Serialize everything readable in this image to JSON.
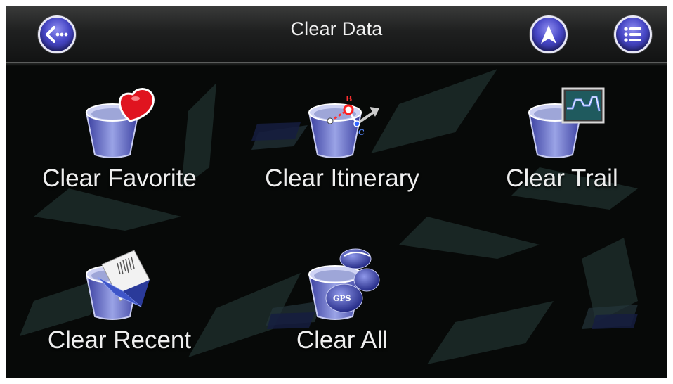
{
  "header": {
    "title": "Clear Data",
    "back_icon": "back-arrow-icon",
    "navigate_icon": "navigation-arrow-icon",
    "menu_icon": "list-menu-icon"
  },
  "colors": {
    "button_blue": "#4747c6",
    "background": "#070908",
    "label_text": "#eeeeee"
  },
  "tiles": [
    {
      "label": "Clear Favorite",
      "icon": "trash-bin-heart-icon"
    },
    {
      "label": "Clear Itinerary",
      "icon": "trash-bin-route-icon"
    },
    {
      "label": "Clear Trail",
      "icon": "trash-bin-trail-icon"
    },
    {
      "label": "Clear Recent",
      "icon": "trash-bin-document-icon"
    },
    {
      "label": "Clear All",
      "icon": "trash-bin-gps-icon"
    }
  ],
  "route_icon_letters": {
    "b": "B",
    "c": "C"
  },
  "gps_icon_text": "GPS"
}
